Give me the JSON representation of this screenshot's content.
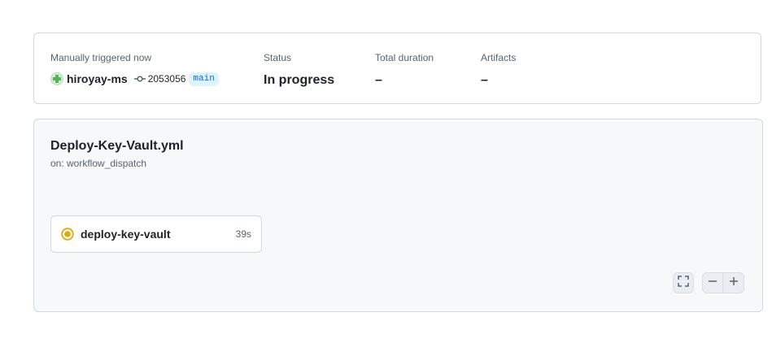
{
  "summary": {
    "trigger_label": "Manually triggered now",
    "actor": "hiroyay-ms",
    "commit_sha": "2053056",
    "branch": "main",
    "status_label": "Status",
    "status_value": "In progress",
    "duration_label": "Total duration",
    "duration_value": "–",
    "artifacts_label": "Artifacts",
    "artifacts_value": "–"
  },
  "workflow": {
    "file_name": "Deploy-Key-Vault.yml",
    "trigger": "on: workflow_dispatch"
  },
  "jobs": [
    {
      "name": "deploy-key-vault",
      "duration": "39s",
      "status": "in_progress",
      "status_color": "#bf8700"
    }
  ],
  "controls": {
    "fullscreen_icon": "screen-full-icon",
    "zoom_out_icon": "dash-icon",
    "zoom_in_icon": "plus-icon"
  },
  "colors": {
    "in_progress": "#dbab0a",
    "branch_text": "#0969da",
    "branch_bg": "#ddf4ff"
  }
}
